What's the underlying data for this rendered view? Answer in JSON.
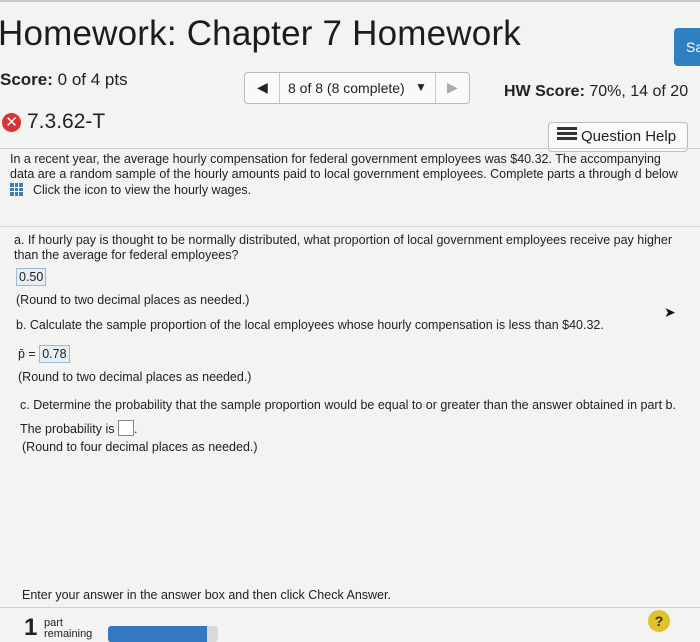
{
  "header": {
    "title": "Homework: Chapter 7 Homework",
    "save_label": "Sa"
  },
  "score": {
    "label": "Score:",
    "value": "0 of 4 pts"
  },
  "nav": {
    "prev_icon": "triangle-left-icon",
    "position_label": "8 of 8 (8 complete)",
    "dropdown_icon": "triangle-down-icon",
    "next_icon": "triangle-right-icon"
  },
  "hw_score": {
    "label": "HW Score:",
    "value": "70%, 14 of 20"
  },
  "question": {
    "id": "7.3.62-T",
    "status_icon": "x-circle-icon",
    "help_label": "Question Help"
  },
  "intro": {
    "line1": "In a recent year, the average hourly compensation for federal government employees was $40.32. The accompanying",
    "line2": "data are a random sample of the hourly amounts paid to local government employees. Complete parts a through d below",
    "line3": "Click the icon to view the hourly wages."
  },
  "part_a": {
    "line1": "a. If hourly pay is thought to be normally distributed, what proportion of local government employees receive pay higher",
    "line2": "than the average for federal employees?",
    "answer": "0.50",
    "note": "(Round to two decimal places as needed.)"
  },
  "part_b": {
    "question": "b. Calculate the sample proportion of the local employees whose hourly compensation is less than $40.32.",
    "symbol": "p̄ =",
    "answer": "0.78",
    "note": "(Round to two decimal places as needed.)"
  },
  "part_c": {
    "question": "c. Determine the probability that the sample proportion would be equal to or greater than the answer obtained in part b.",
    "prompt": "The probability is",
    "period": ".",
    "note": "(Round to four decimal places as needed.)"
  },
  "footer": {
    "instruction": "Enter your answer in the answer box and then click Check Answer.",
    "parts_count": "1",
    "parts_label_1": "part",
    "parts_label_2": "remaining",
    "progress": 0.9,
    "help": "?"
  },
  "colors": {
    "accent": "#2f7fc3",
    "error": "#d93434",
    "answer_bg": "#e7eef5"
  }
}
